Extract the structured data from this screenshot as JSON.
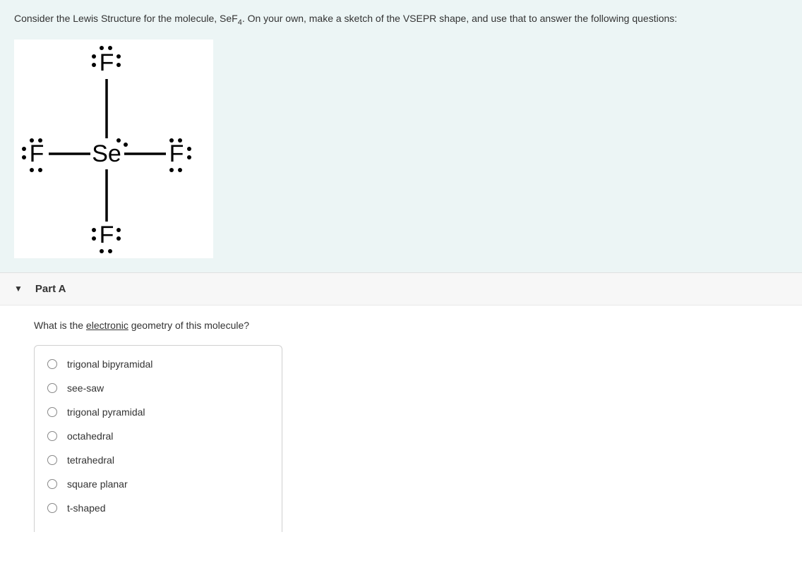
{
  "intro": {
    "text_before": "Consider the Lewis Structure for the molecule, SeF",
    "subscript": "4",
    "text_after": ". On your own, make a sketch of the VSEPR shape, and use that to answer the following questions:"
  },
  "lewis": {
    "center": "Se",
    "top": "F",
    "bottom": "F",
    "left": "F",
    "right": "F"
  },
  "part": {
    "label": "Part A"
  },
  "question": {
    "prefix": "What is the ",
    "underlined": "electronic",
    "suffix": " geometry of this molecule?"
  },
  "options": [
    "trigonal bipyramidal",
    "see-saw",
    "trigonal pyramidal",
    "octahedral",
    "tetrahedral",
    "square planar",
    "t-shaped"
  ]
}
